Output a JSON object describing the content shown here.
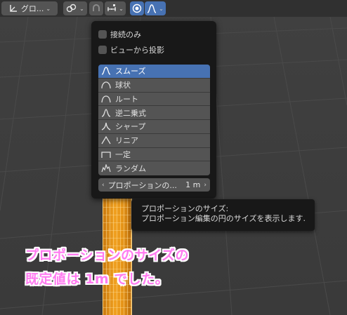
{
  "header": {
    "pivot_label": "グロ...",
    "snap_icon": "link-snap-icon",
    "proportional_icon": "proportional-edit-icon",
    "falloff_icon": "smooth-falloff-icon"
  },
  "falloff_panel": {
    "connected_only_label": "接続のみ",
    "projected_label": "ビューから投影",
    "items": [
      {
        "label": "スムーズ",
        "icon": "smooth-curve-icon",
        "selected": true
      },
      {
        "label": "球状",
        "icon": "sphere-curve-icon",
        "selected": false
      },
      {
        "label": "ルート",
        "icon": "root-curve-icon",
        "selected": false
      },
      {
        "label": "逆二乗式",
        "icon": "inverse-square-curve-icon",
        "selected": false
      },
      {
        "label": "シャープ",
        "icon": "sharp-curve-icon",
        "selected": false
      },
      {
        "label": "リニア",
        "icon": "linear-curve-icon",
        "selected": false
      },
      {
        "label": "一定",
        "icon": "constant-curve-icon",
        "selected": false
      },
      {
        "label": "ランダム",
        "icon": "random-curve-icon",
        "selected": false
      }
    ],
    "size_field": {
      "label": "プロポーションの...",
      "value": "1 m"
    }
  },
  "tooltip": {
    "title": "プロポーションのサイズ:",
    "description": "プロポーション編集の円のサイズを表示します."
  },
  "annotation": {
    "line1": "プロポーションのサイズの",
    "line2": "既定値は 1m でした。"
  },
  "colors": {
    "accent": "#4772b3",
    "panel_bg": "#181818",
    "item_bg": "#545454",
    "annotation_fill": "#ff7bf0",
    "mesh_orange": "#f0a020"
  }
}
